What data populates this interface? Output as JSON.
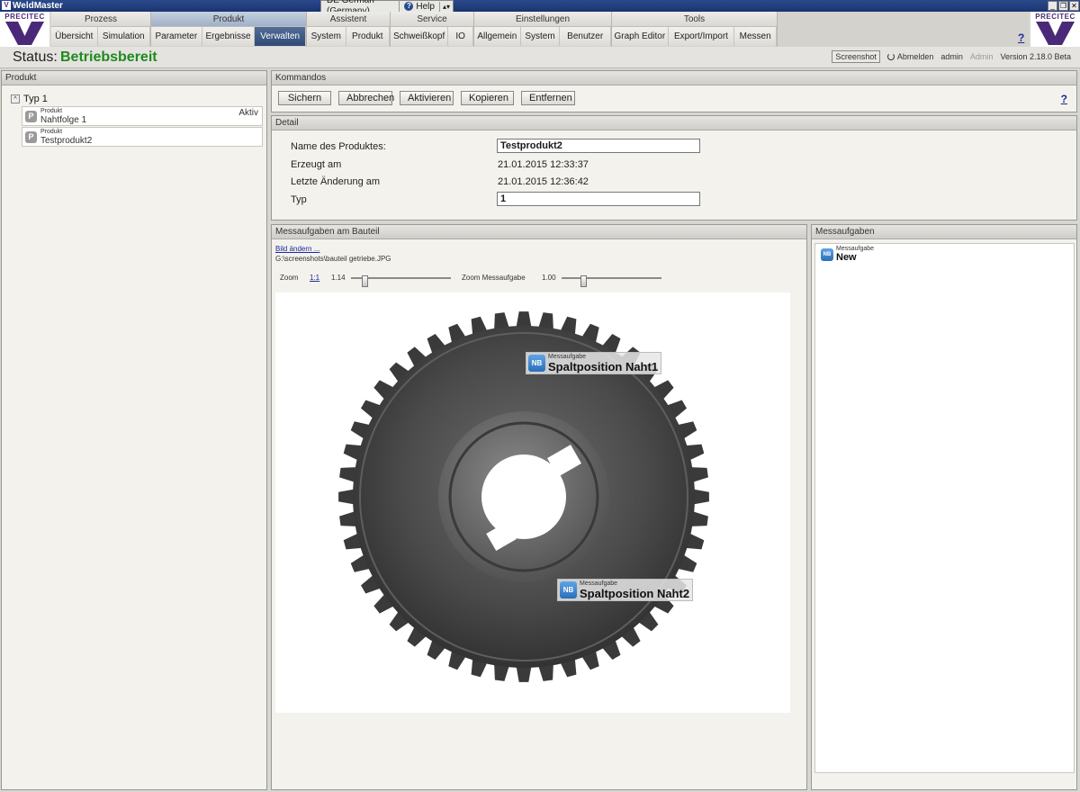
{
  "titlebar": {
    "title": "WeldMaster",
    "language": "DE German (Germany)",
    "help": "Help",
    "window_buttons": [
      "_",
      "❒",
      "✕"
    ]
  },
  "brand": {
    "logo_text": "PRECITEC"
  },
  "menu": {
    "groups": [
      {
        "label": "Prozess",
        "items": [
          "Übersicht",
          "Simulation"
        ]
      },
      {
        "label": "Produkt",
        "items": [
          "Parameter",
          "Ergebnisse",
          "Verwalten"
        ]
      },
      {
        "label": "Assistent",
        "items": [
          "System",
          "Produkt"
        ]
      },
      {
        "label": "Service",
        "items": [
          "Schweißkopf",
          "IO"
        ]
      },
      {
        "label": "Einstellungen",
        "items": [
          "Allgemein",
          "System",
          "Benutzer"
        ]
      },
      {
        "label": "Tools",
        "items": [
          "Graph Editor",
          "Export/Import",
          "Messen"
        ]
      }
    ],
    "selected_item": "Verwalten",
    "help": "?"
  },
  "status": {
    "label": "Status:",
    "value": "Betriebsbereit",
    "screenshot_button": "Screenshot",
    "logout": "Abmelden",
    "user": "admin",
    "role": "Admin",
    "version": "Version 2.18.0 Beta",
    "value_color": "#1e8a1e"
  },
  "produkt_panel": {
    "title": "Produkt",
    "tree_root": "Typ 1",
    "items": [
      {
        "icon": "P",
        "small": "Produkt",
        "name": "Nahtfolge 1",
        "badge": "Aktiv"
      },
      {
        "icon": "P",
        "small": "Produkt",
        "name": "Testprodukt2",
        "badge": ""
      }
    ]
  },
  "kommandos": {
    "title": "Kommandos",
    "buttons": [
      "Sichern",
      "Abbrechen",
      "Aktivieren",
      "Kopieren",
      "Entfernen"
    ],
    "help": "?"
  },
  "detail": {
    "title": "Detail",
    "name_label": "Name des Produktes:",
    "name_value": "Testprodukt2",
    "created_label": "Erzeugt am",
    "created_value": "21.01.2015 12:33:37",
    "changed_label": "Letzte Änderung am",
    "changed_value": "21.01.2015 12:36:42",
    "type_label": "Typ",
    "type_value": "1"
  },
  "bauteil": {
    "title": "Messaufgaben am Bauteil",
    "change_image_link": "Bild ändern ...",
    "image_path": "G:\\screenshots\\bauteil getriebe.JPG",
    "zoom_label": "Zoom",
    "zoom_reset": "1:1",
    "zoom_value": "1.14",
    "zoom_task_label": "Zoom Messaufgabe",
    "zoom_task_value": "1.00",
    "tasks": [
      {
        "icon": "NB",
        "small": "Messaufgabe",
        "name": "Spaltposition Naht1"
      },
      {
        "icon": "NB",
        "small": "Messaufgabe",
        "name": "Spaltposition Naht2"
      }
    ]
  },
  "messaufgaben": {
    "title": "Messaufgaben",
    "entries": [
      {
        "icon": "NB",
        "small": "Messaufgabe",
        "name": "New"
      }
    ]
  }
}
